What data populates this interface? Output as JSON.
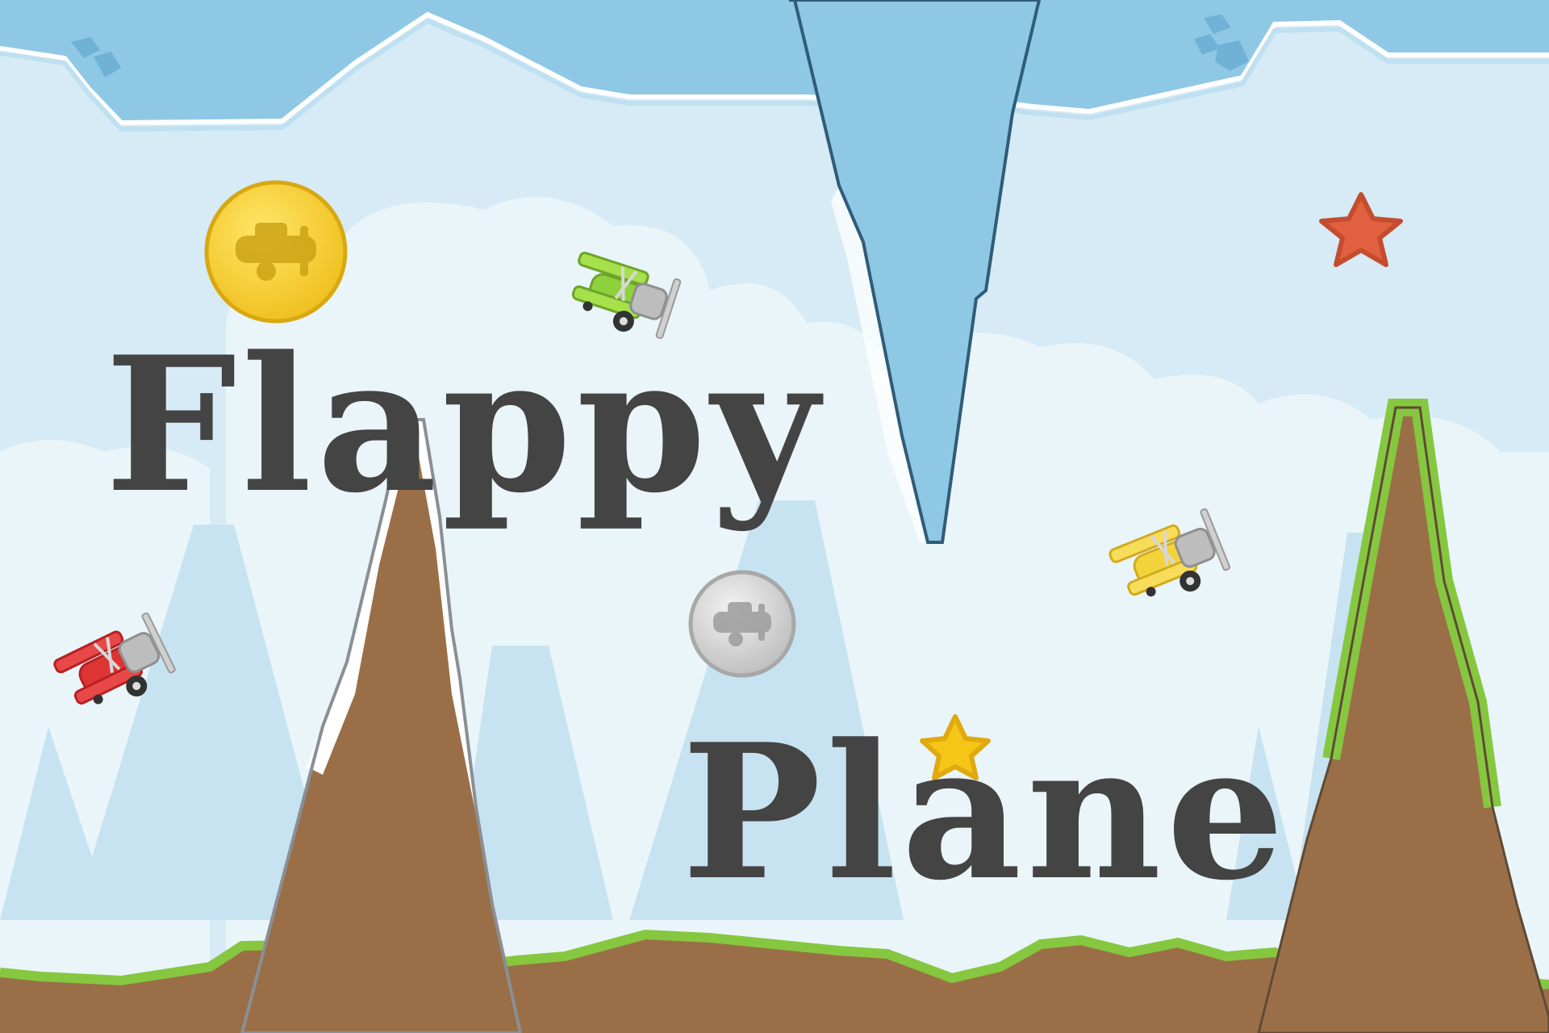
{
  "game": {
    "title_line_1": "Flappy",
    "title_line_2": "Plane"
  },
  "sprites": {
    "planes": [
      {
        "name": "green-plane-icon",
        "color": "#8dd23c"
      },
      {
        "name": "yellow-plane-icon",
        "color": "#f2d33c"
      },
      {
        "name": "red-plane-icon",
        "color": "#dd3434"
      }
    ],
    "coins": [
      {
        "name": "gold-coin-icon",
        "color": "#f5cc2e"
      },
      {
        "name": "silver-coin-icon",
        "color": "#cfcfcf"
      }
    ],
    "stars": [
      {
        "name": "red-star-icon",
        "color": "#e06040"
      },
      {
        "name": "gold-star-icon",
        "color": "#f5c518"
      }
    ]
  },
  "colors": {
    "sky": "#d6ebf5",
    "ice": "#8fc8e5",
    "rock": "#9a6f47",
    "grass": "#86c740",
    "text": "#444444"
  }
}
